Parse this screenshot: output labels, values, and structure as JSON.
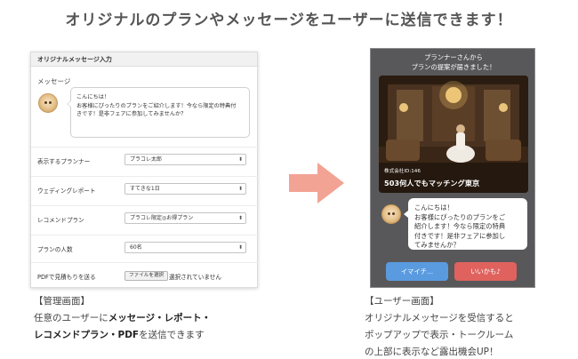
{
  "headline": "オリジナルのプランやメッセージをユーザーに送信できます！",
  "admin": {
    "title": "オリジナルメッセージ入力",
    "message_label": "メッセージ",
    "message_lines": [
      "こんにちは！",
      "お客様にぴったりのプランをご紹介します！今なら限定の特典付",
      "きです！是非フェアに参加してみませんか？"
    ],
    "rows": [
      {
        "label": "表示するプランナー",
        "value": "プラコレ太郎"
      },
      {
        "label": "ウェディングレポート",
        "value": "すてきな1日"
      },
      {
        "label": "レコメンドプラン",
        "value": "プラコレ限定◎お得プラン"
      },
      {
        "label": "プランの人数",
        "value": "60名"
      }
    ],
    "pdf_label": "PDFで見積もりを送る",
    "file_button": "ファイルを選択",
    "file_status": "選択されていません"
  },
  "admin_caption": {
    "line1": "【管理画面】",
    "line2_prefix": "任意のユーザーに",
    "line2_bold": "メッセージ・レポート・",
    "line3_bold": "レコメンドプラン・PDF",
    "line3_suffix": "を送信できます"
  },
  "phone": {
    "notice_lines": [
      "プランナーさんから",
      "プランの提案が届きました！"
    ],
    "company_id": "株式会社ID:146",
    "company_name": "503何人でもマッチング東京",
    "message_lines": [
      "こんにちは！",
      "お客様にぴったりのプランをご",
      "紹介します！今なら限定の特典",
      "付きです！是非フェアに参加し",
      "てみませんか？"
    ],
    "button_blue": "イマイチ…",
    "button_red": "いいかも♪"
  },
  "user_caption": {
    "lines": [
      "【ユーザー画面】",
      "オリジナルメッセージを受信すると",
      "ポップアップで表示・トークルーム",
      "の上部に表示など露出機会UP！"
    ]
  },
  "colors": {
    "arrow": "#f2a394",
    "phone_bg": "#58585a",
    "button_blue": "#5a9be0",
    "button_red": "#e0625e"
  },
  "icons": [
    "arrow-right-icon",
    "chevron-updown-icon",
    "planner-avatar"
  ]
}
